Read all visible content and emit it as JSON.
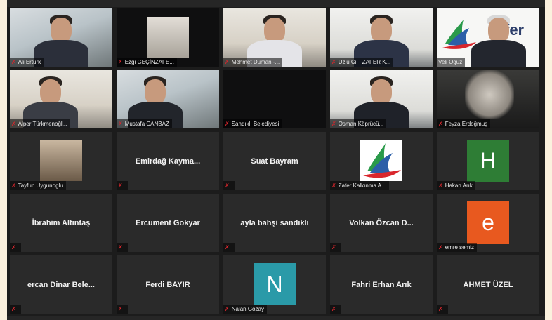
{
  "colors": {
    "page_bg": "#fbf1de",
    "frame_bg": "#1c1c1c",
    "tile_bg": "#2a2a2a",
    "active_speaker_border": "#c9cf4a",
    "muted_mic": "#d9262c"
  },
  "icons": {
    "muted": "muted-mic-icon"
  },
  "participants": [
    {
      "name": "Ali Ertürk",
      "video": "photo",
      "muted": true
    },
    {
      "name": "Ezgi GEÇİNZAFE...",
      "video": "photo",
      "muted": true
    },
    {
      "name": "Mehmet Duman -...",
      "video": "photo",
      "muted": true
    },
    {
      "name": "Uzlu Cil | ZAFER K...",
      "video": "photo",
      "muted": true
    },
    {
      "name": "Veli Oğuz",
      "video": "photo",
      "muted": false,
      "active_speaker": true,
      "background_logo_text": "fer"
    },
    {
      "name": "Alper Türkmenoğl...",
      "video": "photo",
      "muted": true
    },
    {
      "name": "Mustafa CANBAZ",
      "video": "photo",
      "muted": true
    },
    {
      "name": "Sandıklı Belediyesi",
      "video": "off",
      "muted": true
    },
    {
      "name": "Osman Köprücü...",
      "video": "photo",
      "muted": true
    },
    {
      "name": "Feyza Erdoğmuş",
      "video": "photo",
      "muted": true
    },
    {
      "name": "Tayfun Uygunoglu",
      "video": "profile-photo",
      "muted": true
    },
    {
      "center_name": "Emirdağ Kayma...",
      "muted": true
    },
    {
      "center_name": "Suat Bayram",
      "muted": true
    },
    {
      "name": "Zafer Kalkınma A...",
      "video": "logo",
      "muted": true
    },
    {
      "name": "Hakan Arık",
      "avatar_letter": "H",
      "avatar_color": "#2e7d35",
      "muted": true
    },
    {
      "center_name": "İbrahim Altıntaş",
      "muted": true
    },
    {
      "center_name": "Ercument Gokyar",
      "muted": true
    },
    {
      "center_name": "ayla bahşi sandıklı",
      "muted": true
    },
    {
      "center_name": "Volkan Özcan D...",
      "muted": true
    },
    {
      "name": "emre semiz",
      "avatar_letter": "e",
      "avatar_color": "#e8591f",
      "muted": true
    },
    {
      "center_name": "ercan Dinar Bele...",
      "muted": true
    },
    {
      "center_name": "Ferdi BAYIR",
      "muted": true
    },
    {
      "name": "Nalan Gözay",
      "avatar_letter": "N",
      "avatar_color": "#2a9aa8",
      "muted": true
    },
    {
      "center_name": "Fahri Erhan Arık",
      "muted": true
    },
    {
      "center_name": "AHMET ÜZEL",
      "muted": true
    }
  ]
}
